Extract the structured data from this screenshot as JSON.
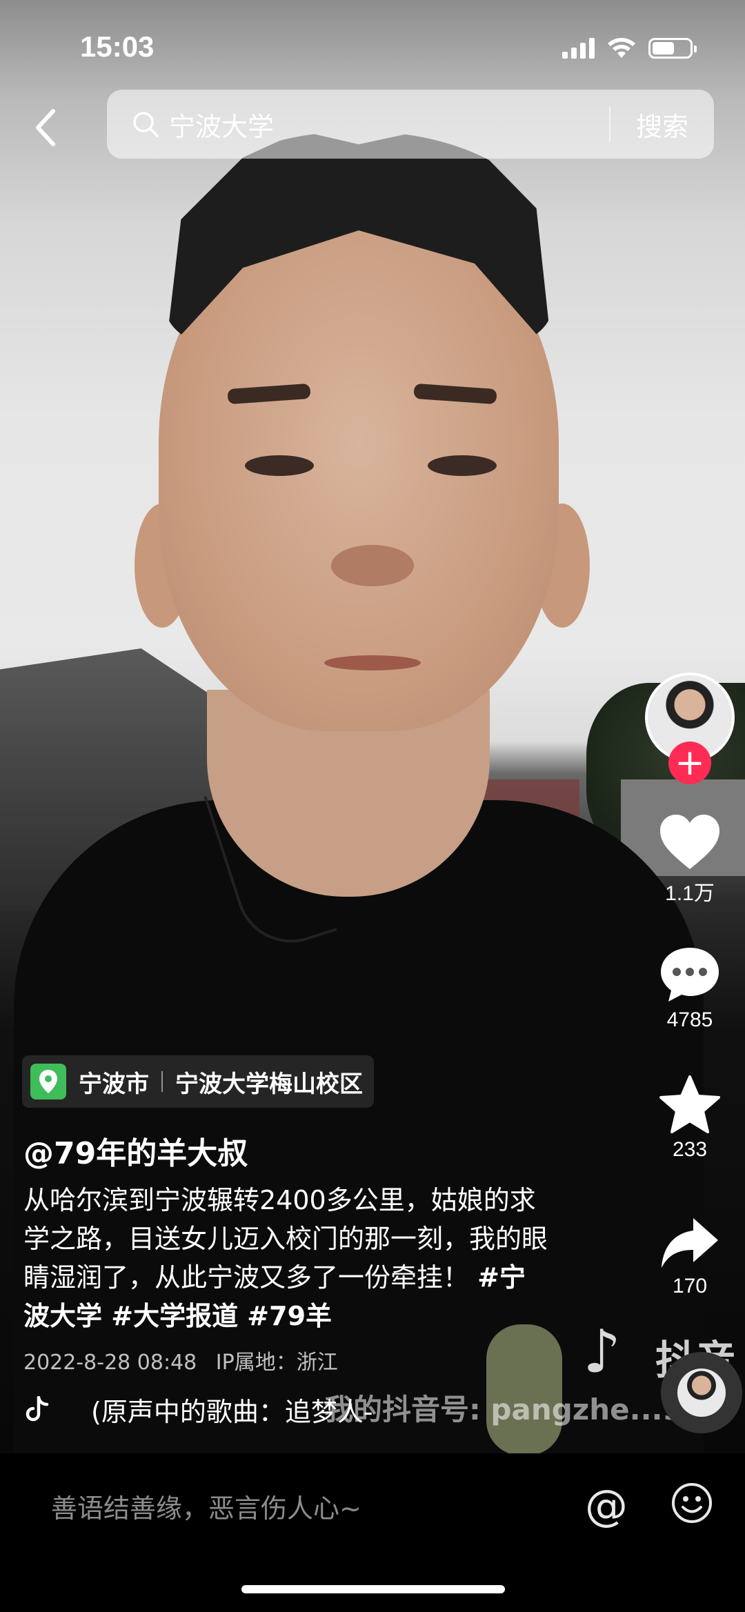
{
  "status_bar": {
    "time": "15:03",
    "signal": "signal-icon",
    "wifi": "wifi-icon",
    "battery_level": 0.6
  },
  "search": {
    "query": "宁波大学",
    "button_label": "搜索"
  },
  "actions": {
    "likes": "1.1万",
    "comments": "4785",
    "favorites": "233",
    "shares": "170"
  },
  "location": {
    "city": "宁波市",
    "place": "宁波大学梅山校区"
  },
  "post": {
    "author": "@79年的羊大叔",
    "description": "从哈尔滨到宁波辗转2400多公里，姑娘的求学之路，目送女儿迈入校门的那一刻，我的眼睛湿润了，从此宁波又多了一份牵挂！",
    "tags": "#宁波大学 #大学报道 #79羊",
    "date": "2022-8-28 08:48",
    "ip": "IP属地：浙江",
    "music": "(原声中的歌曲：追梦人-"
  },
  "watermark": {
    "brand": "抖音",
    "id_text": "我的抖音号: pangzhe...9"
  },
  "comment_bar": {
    "placeholder": "善语结善缘，恶言伤人心~"
  },
  "colors": {
    "follow_red": "#fe2c55",
    "location_green": "#3fbd5a"
  }
}
